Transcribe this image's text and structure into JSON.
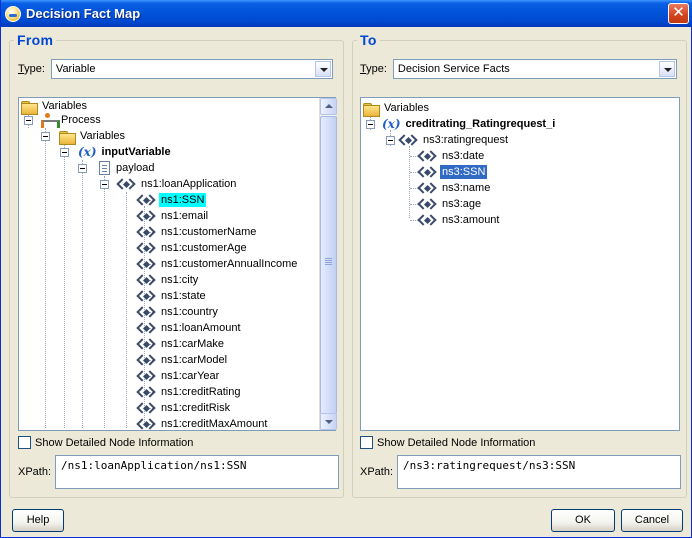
{
  "window": {
    "title": "Decision Fact Map",
    "close_glyph": "✕"
  },
  "from": {
    "legend": "From",
    "type_label": "Type:",
    "type_value": "Variable",
    "tree": {
      "variables": "Variables",
      "process": "Process",
      "variables2": "Variables",
      "input_variable": "inputVariable",
      "payload": "payload",
      "loan_application": "ns1:loanApplication",
      "fields": [
        "ns1:SSN",
        "ns1:email",
        "ns1:customerName",
        "ns1:customerAge",
        "ns1:customerAnnualIncome",
        "ns1:city",
        "ns1:state",
        "ns1:country",
        "ns1:loanAmount",
        "ns1:carMake",
        "ns1:carModel",
        "ns1:carYear",
        "ns1:creditRating",
        "ns1:creditRisk",
        "ns1:creditMaxAmount"
      ],
      "selected": "ns1:SSN"
    },
    "show_details_label": "Show Detailed Node Information",
    "xpath_label": "XPath:",
    "xpath_value": "/ns1:loanApplication/ns1:SSN"
  },
  "to": {
    "legend": "To",
    "type_label": "Type:",
    "type_value": "Decision Service Facts",
    "tree": {
      "variables": "Variables",
      "rating_var": "creditrating_Ratingrequest_i",
      "rating_request": "ns3:ratingrequest",
      "fields": [
        "ns3:date",
        "ns3:SSN",
        "ns3:name",
        "ns3:age",
        "ns3:amount"
      ],
      "selected": "ns3:SSN"
    },
    "show_details_label": "Show Detailed Node Information",
    "xpath_label": "XPath:",
    "xpath_value": "/ns3:ratingrequest/ns3:SSN"
  },
  "buttons": {
    "help": "Help",
    "ok": "OK",
    "cancel": "Cancel"
  },
  "icons": {
    "folder": "folder-icon",
    "process": "process-icon",
    "variable": "variable-icon",
    "element": "element-icon",
    "document": "document-icon"
  },
  "colors": {
    "title_bar": "#0254d8",
    "legend_text": "#0046d5",
    "selection_cyan": "#00ffff",
    "selection_blue": "#316ac5"
  }
}
